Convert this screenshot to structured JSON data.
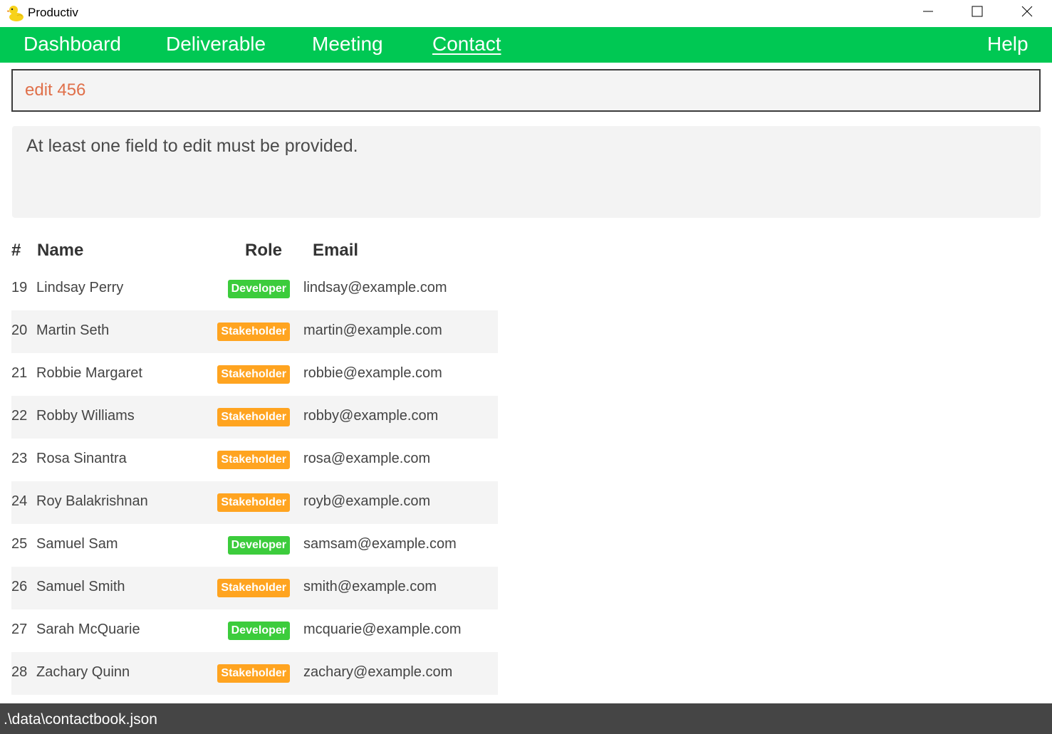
{
  "window": {
    "title": "Productiv",
    "icon": "duck-icon"
  },
  "menu": {
    "items": [
      {
        "label": "Dashboard",
        "active": false
      },
      {
        "label": "Deliverable",
        "active": false
      },
      {
        "label": "Meeting",
        "active": false
      },
      {
        "label": "Contact",
        "active": true
      }
    ],
    "help_label": "Help",
    "background_color": "#00c853"
  },
  "command": {
    "value": "edit 456",
    "text_color": "#e0704a"
  },
  "result": {
    "message": "At least one field to edit must be provided."
  },
  "table": {
    "headers": {
      "index": "#",
      "name": "Name",
      "role": "Role",
      "email": "Email"
    },
    "rows": [
      {
        "index": "19",
        "name": "Lindsay Perry",
        "role": "Developer",
        "email": "lindsay@example.com"
      },
      {
        "index": "20",
        "name": "Martin Seth",
        "role": "Stakeholder",
        "email": "martin@example.com"
      },
      {
        "index": "21",
        "name": "Robbie Margaret",
        "role": "Stakeholder",
        "email": "robbie@example.com"
      },
      {
        "index": "22",
        "name": "Robby Williams",
        "role": "Stakeholder",
        "email": "robby@example.com"
      },
      {
        "index": "23",
        "name": "Rosa Sinantra",
        "role": "Stakeholder",
        "email": "rosa@example.com"
      },
      {
        "index": "24",
        "name": "Roy Balakrishnan",
        "role": "Stakeholder",
        "email": "royb@example.com"
      },
      {
        "index": "25",
        "name": "Samuel Sam",
        "role": "Developer",
        "email": "samsam@example.com"
      },
      {
        "index": "26",
        "name": "Samuel Smith",
        "role": "Stakeholder",
        "email": "smith@example.com"
      },
      {
        "index": "27",
        "name": "Sarah McQuarie",
        "role": "Developer",
        "email": "mcquarie@example.com"
      },
      {
        "index": "28",
        "name": "Zachary Quinn",
        "role": "Stakeholder",
        "email": "zachary@example.com"
      }
    ],
    "role_colors": {
      "Developer": "#3ccc3c",
      "Stakeholder": "#ffa420"
    }
  },
  "status": {
    "path": ".\\data\\contactbook.json"
  }
}
